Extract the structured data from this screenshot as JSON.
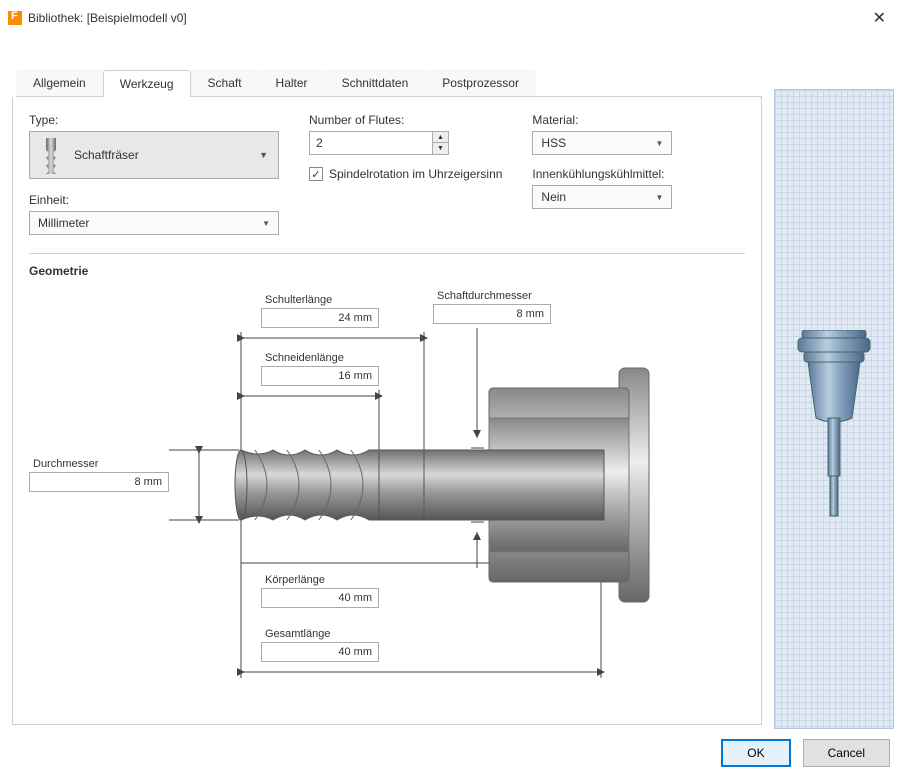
{
  "title": "Bibliothek:  [Beispielmodell v0]",
  "tabs": {
    "allgemein": "Allgemein",
    "werkzeug": "Werkzeug",
    "schaft": "Schaft",
    "halter": "Halter",
    "schnittdaten": "Schnittdaten",
    "postprozessor": "Postprozessor"
  },
  "form": {
    "type_label": "Type:",
    "type_value": "Schaftfräser",
    "unit_label": "Einheit:",
    "unit_value": "Millimeter",
    "flutes_label": "Number of Flutes:",
    "flutes_value": "2",
    "spindle_rot_label": "Spindelrotation im Uhrzeigersinn",
    "spindle_rot_checked": "✓",
    "material_label": "Material:",
    "material_value": "HSS",
    "coolant_label": "Innenkühlungskühlmittel:",
    "coolant_value": "Nein"
  },
  "geometry": {
    "header": "Geometrie",
    "schulterlaenge_label": "Schulterlänge",
    "schulterlaenge_value": "24 mm",
    "schneidenlaenge_label": "Schneidenlänge",
    "schneidenlaenge_value": "16 mm",
    "durchmesser_label": "Durchmesser",
    "durchmesser_value": "8 mm",
    "koerperlaenge_label": "Körperlänge",
    "koerperlaenge_value": "40 mm",
    "gesamtlaenge_label": "Gesamtlänge",
    "gesamtlaenge_value": "40 mm",
    "schaftdurchmesser_label": "Schaftdurchmesser",
    "schaftdurchmesser_value": "8 mm"
  },
  "buttons": {
    "ok": "OK",
    "cancel": "Cancel"
  }
}
